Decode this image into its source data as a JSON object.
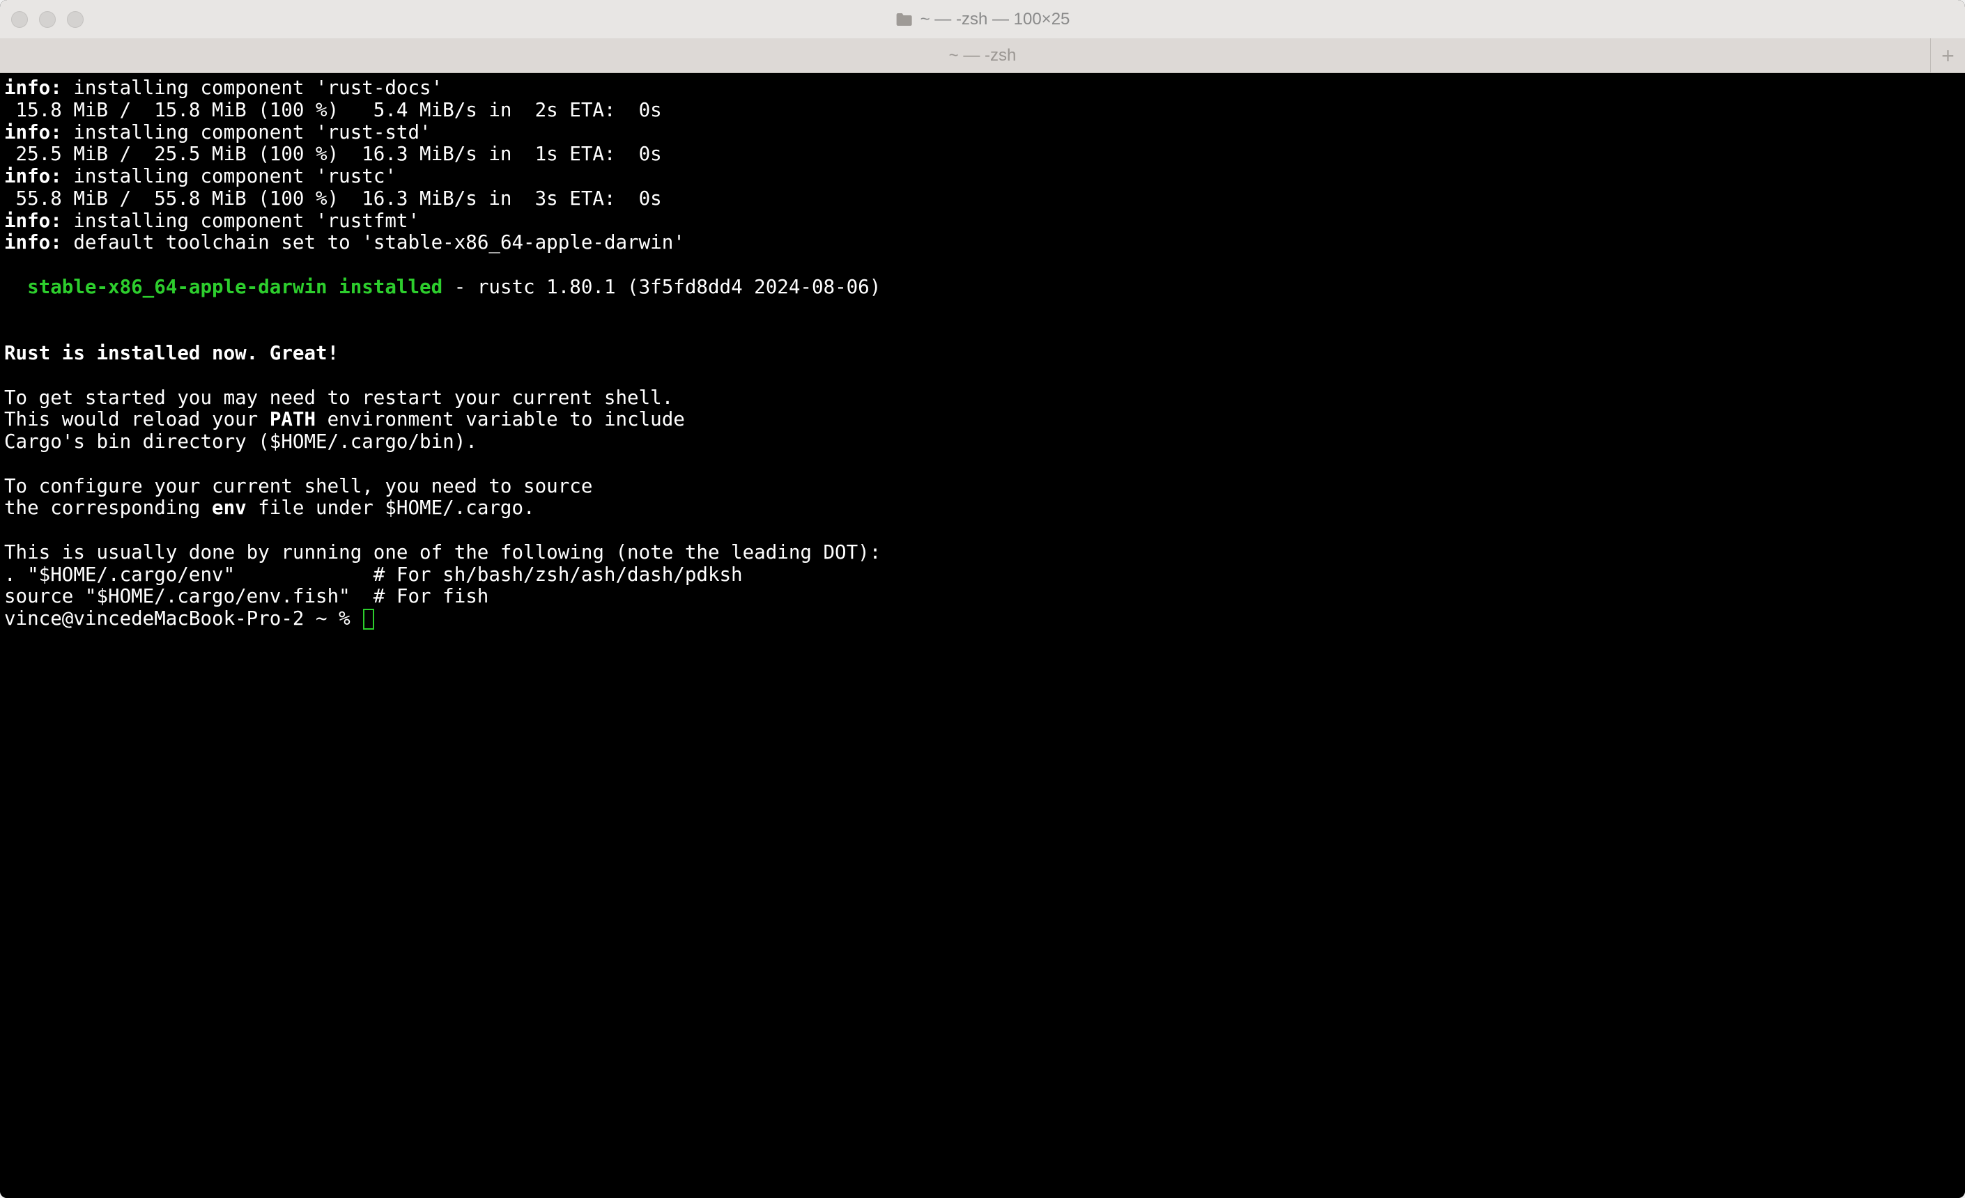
{
  "window": {
    "title": "~ — -zsh — 100×25",
    "tab_label": "~ — -zsh",
    "new_tab_glyph": "+"
  },
  "terminal": {
    "lines": [
      {
        "segments": [
          {
            "text": "info:",
            "bold": true
          },
          {
            "text": " installing component 'rust-docs'"
          }
        ]
      },
      {
        "segments": [
          {
            "text": " 15.8 MiB /  15.8 MiB (100 %)   5.4 MiB/s in  2s ETA:  0s"
          }
        ]
      },
      {
        "segments": [
          {
            "text": "info:",
            "bold": true
          },
          {
            "text": " installing component 'rust-std'"
          }
        ]
      },
      {
        "segments": [
          {
            "text": " 25.5 MiB /  25.5 MiB (100 %)  16.3 MiB/s in  1s ETA:  0s"
          }
        ]
      },
      {
        "segments": [
          {
            "text": "info:",
            "bold": true
          },
          {
            "text": " installing component 'rustc'"
          }
        ]
      },
      {
        "segments": [
          {
            "text": " 55.8 MiB /  55.8 MiB (100 %)  16.3 MiB/s in  3s ETA:  0s"
          }
        ]
      },
      {
        "segments": [
          {
            "text": "info:",
            "bold": true
          },
          {
            "text": " installing component 'rustfmt'"
          }
        ]
      },
      {
        "segments": [
          {
            "text": "info:",
            "bold": true
          },
          {
            "text": " default toolchain set to 'stable-x86_64-apple-darwin'"
          }
        ]
      },
      {
        "segments": [
          {
            "text": ""
          }
        ]
      },
      {
        "segments": [
          {
            "text": "  stable-x86_64-apple-darwin installed",
            "green": true,
            "bold": true
          },
          {
            "text": " - rustc 1.80.1 (3f5fd8dd4 2024-08-06)"
          }
        ]
      },
      {
        "segments": [
          {
            "text": ""
          }
        ]
      },
      {
        "segments": [
          {
            "text": ""
          }
        ]
      },
      {
        "segments": [
          {
            "text": "Rust is installed now. Great!",
            "bold": true
          }
        ]
      },
      {
        "segments": [
          {
            "text": ""
          }
        ]
      },
      {
        "segments": [
          {
            "text": "To get started you may need to restart your current shell."
          }
        ]
      },
      {
        "segments": [
          {
            "text": "This would reload your "
          },
          {
            "text": "PATH",
            "bold": true
          },
          {
            "text": " environment variable to include"
          }
        ]
      },
      {
        "segments": [
          {
            "text": "Cargo's bin directory ($HOME/.cargo/bin)."
          }
        ]
      },
      {
        "segments": [
          {
            "text": ""
          }
        ]
      },
      {
        "segments": [
          {
            "text": "To configure your current shell, you need to source"
          }
        ]
      },
      {
        "segments": [
          {
            "text": "the corresponding "
          },
          {
            "text": "env",
            "bold": true
          },
          {
            "text": " file under $HOME/.cargo."
          }
        ]
      },
      {
        "segments": [
          {
            "text": ""
          }
        ]
      },
      {
        "segments": [
          {
            "text": "This is usually done by running one of the following (note the leading DOT):"
          }
        ]
      },
      {
        "segments": [
          {
            "text": ". \"$HOME/.cargo/env\"            # For sh/bash/zsh/ash/dash/pdksh"
          }
        ]
      },
      {
        "segments": [
          {
            "text": "source \"$HOME/.cargo/env.fish\"  # For fish"
          }
        ]
      }
    ],
    "prompt": "vince@vincedeMacBook-Pro-2 ~ % "
  }
}
